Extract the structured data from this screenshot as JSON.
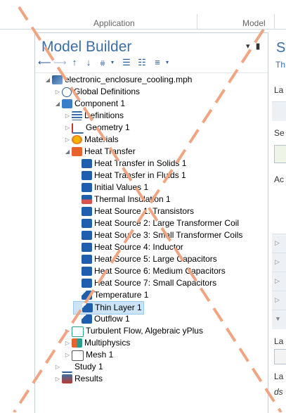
{
  "ribbon": {
    "application_label": "Application",
    "model_label": "Model"
  },
  "model_builder": {
    "title": "Model Builder",
    "toolbar_icons": [
      "back-arrow-icon",
      "forward-arrow-icon",
      "up-arrow-icon",
      "down-arrow-icon",
      "filter-icon",
      "collapse-icon",
      "expand-icon",
      "list-icon"
    ]
  },
  "tree": [
    {
      "label": "electronic_enclosure_cooling.mph",
      "icon": "model-icon",
      "toggle": "▲",
      "level": 0
    },
    {
      "label": "Global Definitions",
      "icon": "globe-icon",
      "toggle": "▷",
      "level": 1
    },
    {
      "label": "Component 1",
      "icon": "component-icon",
      "toggle": "▲",
      "level": 1
    },
    {
      "label": "Definitions",
      "icon": "definitions-icon",
      "toggle": "▷",
      "level": 2
    },
    {
      "label": "Geometry 1",
      "icon": "geometry-icon",
      "toggle": "▷",
      "level": 2
    },
    {
      "label": "Materials",
      "icon": "materials-icon",
      "toggle": "▷",
      "level": 2
    },
    {
      "label": "Heat Transfer",
      "icon": "heat-transfer-icon",
      "toggle": "▲",
      "level": 2
    },
    {
      "label": "Heat Transfer in Solids 1",
      "icon": "feature-icon",
      "toggle": "",
      "level": 3
    },
    {
      "label": "Heat Transfer in Fluids 1",
      "icon": "feature-icon",
      "toggle": "",
      "level": 3
    },
    {
      "label": "Initial Values 1",
      "icon": "feature-icon",
      "toggle": "",
      "level": 3
    },
    {
      "label": "Thermal Insulation 1",
      "icon": "insulation-icon",
      "toggle": "",
      "level": 3
    },
    {
      "label": "Heat Source 1: Transistors",
      "icon": "feature-icon",
      "toggle": "",
      "level": 3
    },
    {
      "label": "Heat Source 2: Large Transformer Coil",
      "icon": "feature-icon",
      "toggle": "",
      "level": 3
    },
    {
      "label": "Heat Source 3: Small Transformer Coils",
      "icon": "feature-icon",
      "toggle": "",
      "level": 3
    },
    {
      "label": "Heat Source 4: Inductor",
      "icon": "feature-icon",
      "toggle": "",
      "level": 3
    },
    {
      "label": "Heat Source 5: Large Capacitors",
      "icon": "feature-icon",
      "toggle": "",
      "level": 3
    },
    {
      "label": "Heat Source 6: Medium Capacitors",
      "icon": "feature-icon",
      "toggle": "",
      "level": 3
    },
    {
      "label": "Heat Source 7: Small Capacitors",
      "icon": "feature-icon",
      "toggle": "",
      "level": 3
    },
    {
      "label": "Temperature 1",
      "icon": "boundary-icon",
      "toggle": "",
      "level": 3
    },
    {
      "label": "Thin Layer 1",
      "icon": "boundary-icon",
      "toggle": "",
      "level": 3,
      "selected": true
    },
    {
      "label": "Outflow 1",
      "icon": "boundary-icon",
      "toggle": "",
      "level": 3
    },
    {
      "label": "Turbulent Flow, Algebraic yPlus",
      "icon": "flow-icon",
      "toggle": "▷",
      "level": 2
    },
    {
      "label": "Multiphysics",
      "icon": "multiphysics-icon",
      "toggle": "▷",
      "level": 2
    },
    {
      "label": "Mesh 1",
      "icon": "mesh-icon",
      "toggle": "▷",
      "level": 2
    },
    {
      "label": "Study 1",
      "icon": "study-icon",
      "toggle": "▷",
      "level": 1
    },
    {
      "label": "Results",
      "icon": "results-icon",
      "toggle": "▷",
      "level": 1
    }
  ],
  "right_panel": {
    "title": "S",
    "subtitle": "Th",
    "label1": "La",
    "label2": "Se",
    "label3": "Ac",
    "label4": "La",
    "label5": "La",
    "label6": "ds"
  },
  "colors": {
    "accent": "#3b6ea8",
    "selection": "#cce4f7",
    "annotation": "#f0a582"
  }
}
